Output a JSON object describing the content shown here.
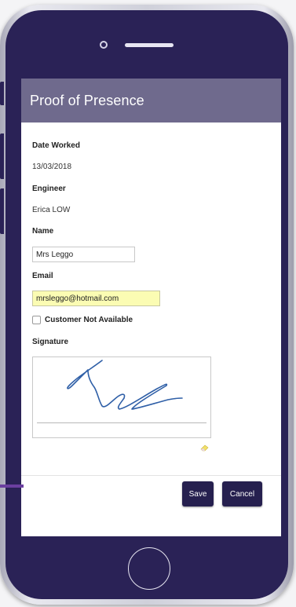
{
  "app": {
    "title": "Proof of Presence"
  },
  "form": {
    "date_worked_label": "Date Worked",
    "date_worked_value": "13/03/2018",
    "engineer_label": "Engineer",
    "engineer_value": "Erica LOW",
    "name_label": "Name",
    "name_value": "Mrs Leggo",
    "email_label": "Email",
    "email_value": "mrsleggo@hotmail.com",
    "customer_not_available_label": "Customer Not Available",
    "customer_not_available_checked": false,
    "signature_label": "Signature"
  },
  "actions": {
    "save_label": "Save",
    "cancel_label": "Cancel"
  },
  "icons": {
    "eraser": "eraser-icon",
    "camera": "camera-icon",
    "speaker": "speaker-icon",
    "home": "home-button-icon"
  },
  "colors": {
    "phone_body": "#2a2256",
    "title_bar": "#6f6a8d",
    "button": "#26204f",
    "email_highlight": "#fbfcb3",
    "signature_ink": "#2f5fa7"
  }
}
